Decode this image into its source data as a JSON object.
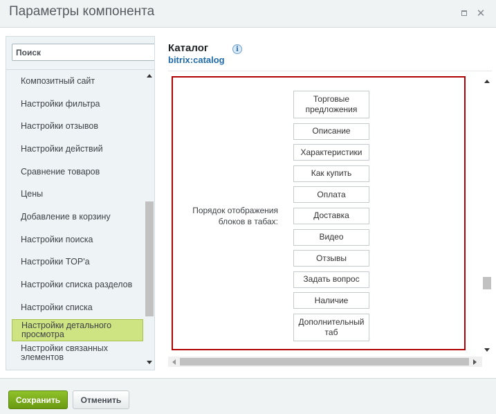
{
  "window": {
    "title": "Параметры компонента",
    "maximize_icon": "maximize-icon",
    "close_icon": "close-icon",
    "close_glyph": "✕"
  },
  "sidebar": {
    "search_placeholder": "Поиск",
    "search_value": "",
    "items": [
      {
        "label": "Композитный сайт",
        "active": false
      },
      {
        "label": "Настройки фильтра",
        "active": false
      },
      {
        "label": "Настройки отзывов",
        "active": false
      },
      {
        "label": "Настройки действий",
        "active": false
      },
      {
        "label": "Сравнение товаров",
        "active": false
      },
      {
        "label": "Цены",
        "active": false
      },
      {
        "label": "Добавление в корзину",
        "active": false
      },
      {
        "label": "Настройки поиска",
        "active": false
      },
      {
        "label": "Настройки TOP'а",
        "active": false
      },
      {
        "label": "Настройки списка разделов",
        "active": false
      },
      {
        "label": "Настройки списка",
        "active": false
      },
      {
        "label": "Настройки детального просмотра",
        "active": true
      },
      {
        "label": "Настройки связанных элементов",
        "active": false
      }
    ]
  },
  "component": {
    "title": "Каталог",
    "code": "bitrix:catalog",
    "info_icon": "info-icon",
    "info_glyph": "i"
  },
  "property": {
    "label": "Порядок отображения блоков в табах:",
    "blocks": [
      {
        "label": "Торговые предложения",
        "tall": true
      },
      {
        "label": "Описание",
        "tall": false
      },
      {
        "label": "Характеристики",
        "tall": false
      },
      {
        "label": "Как купить",
        "tall": false
      },
      {
        "label": "Оплата",
        "tall": false
      },
      {
        "label": "Доставка",
        "tall": false
      },
      {
        "label": "Видео",
        "tall": false
      },
      {
        "label": "Отзывы",
        "tall": false
      },
      {
        "label": "Задать вопрос",
        "tall": false
      },
      {
        "label": "Наличие",
        "tall": false
      },
      {
        "label": "Дополнительный таб",
        "tall": true
      }
    ]
  },
  "footer": {
    "save_label": "Сохранить",
    "cancel_label": "Отменить"
  },
  "colors": {
    "accent_green": "#7cad1e",
    "active_item": "#cee382",
    "highlight_border": "#b20000",
    "link_blue": "#1e6aa9"
  }
}
